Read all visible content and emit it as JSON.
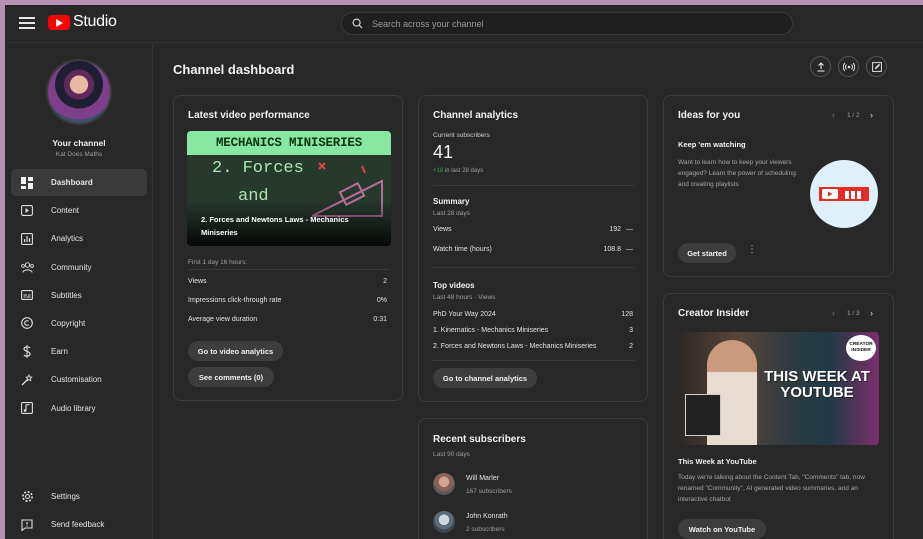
{
  "header": {
    "logo_text": "Studio",
    "search_placeholder": "Search across your channel"
  },
  "sidebar": {
    "your_channel": "Your channel",
    "channel_name": "Kat Does Maths",
    "items": [
      {
        "label": "Dashboard",
        "icon": "dashboard-icon",
        "active": true
      },
      {
        "label": "Content",
        "icon": "content-icon"
      },
      {
        "label": "Analytics",
        "icon": "analytics-icon"
      },
      {
        "label": "Community",
        "icon": "community-icon"
      },
      {
        "label": "Subtitles",
        "icon": "subtitles-icon"
      },
      {
        "label": "Copyright",
        "icon": "copyright-icon"
      },
      {
        "label": "Earn",
        "icon": "earn-icon"
      },
      {
        "label": "Customisation",
        "icon": "customisation-icon"
      },
      {
        "label": "Audio library",
        "icon": "audio-library-icon"
      }
    ],
    "bottom_items": [
      {
        "label": "Settings",
        "icon": "settings-icon"
      },
      {
        "label": "Send feedback",
        "icon": "feedback-icon"
      }
    ]
  },
  "main": {
    "title": "Channel dashboard",
    "latest_video": {
      "title": "Latest video performance",
      "thumb_banner": "MECHANICS MINISERIES",
      "thumb_line1": "2. Forces",
      "thumb_line2": "and",
      "video_title": "2. Forces and Newtons Laws - Mechanics Miniseries",
      "period": "First 1 day 16 hours:",
      "stats": [
        {
          "label": "Views",
          "value": "2"
        },
        {
          "label": "Impressions click-through rate",
          "value": "0%"
        },
        {
          "label": "Average view duration",
          "value": "0:31"
        }
      ],
      "btn_analytics": "Go to video analytics",
      "btn_comments": "See comments (0)"
    },
    "analytics": {
      "title": "Channel analytics",
      "current_subs_label": "Current subscribers",
      "current_subs": "41",
      "subs_change": "+18",
      "subs_change_suffix": "in last 28 days",
      "summary_title": "Summary",
      "summary_period": "Last 28 days",
      "summary_rows": [
        {
          "label": "Views",
          "value": "192",
          "trend": "—"
        },
        {
          "label": "Watch time (hours)",
          "value": "108.8",
          "trend": "—"
        }
      ],
      "top_videos_title": "Top videos",
      "top_videos_period": "Last 48 hours · Views",
      "top_videos": [
        {
          "label": "PhD Your Way 2024",
          "value": "128"
        },
        {
          "label": "1. Kinematics - Mechanics Miniseries",
          "value": "3"
        },
        {
          "label": "2. Forces and Newtons Laws - Mechanics Miniseries",
          "value": "2"
        }
      ],
      "btn": "Go to channel analytics"
    },
    "recent_subs": {
      "title": "Recent subscribers",
      "period": "Last 90 days",
      "items": [
        {
          "name": "Will Marler",
          "subs": "167 subscribers"
        },
        {
          "name": "John Konrath",
          "subs": "2 subscribers"
        }
      ]
    },
    "ideas": {
      "title": "Ideas for you",
      "pager": "1 / 2",
      "heading": "Keep 'em watching",
      "body": "Want to learn how to keep your viewers engaged? Learn the power of scheduling and creating playlists",
      "btn": "Get started"
    },
    "insider": {
      "title": "Creator Insider",
      "pager": "1 / 3",
      "badge_line1": "CREATOR",
      "badge_line2": "INSIDER",
      "headline": "THIS WEEK AT YOUTUBE",
      "video_title": "This Week at YouTube",
      "body": "Today we're talking about the Content Tab, \"Comments\" tab, now renamed \"Community\", AI generated video summaries, and an interactive chatbot",
      "btn": "Watch on YouTube"
    }
  },
  "colors": {
    "accent_red": "#ff0000",
    "positive_green": "#2ba640",
    "page_border": "#b591b3"
  }
}
